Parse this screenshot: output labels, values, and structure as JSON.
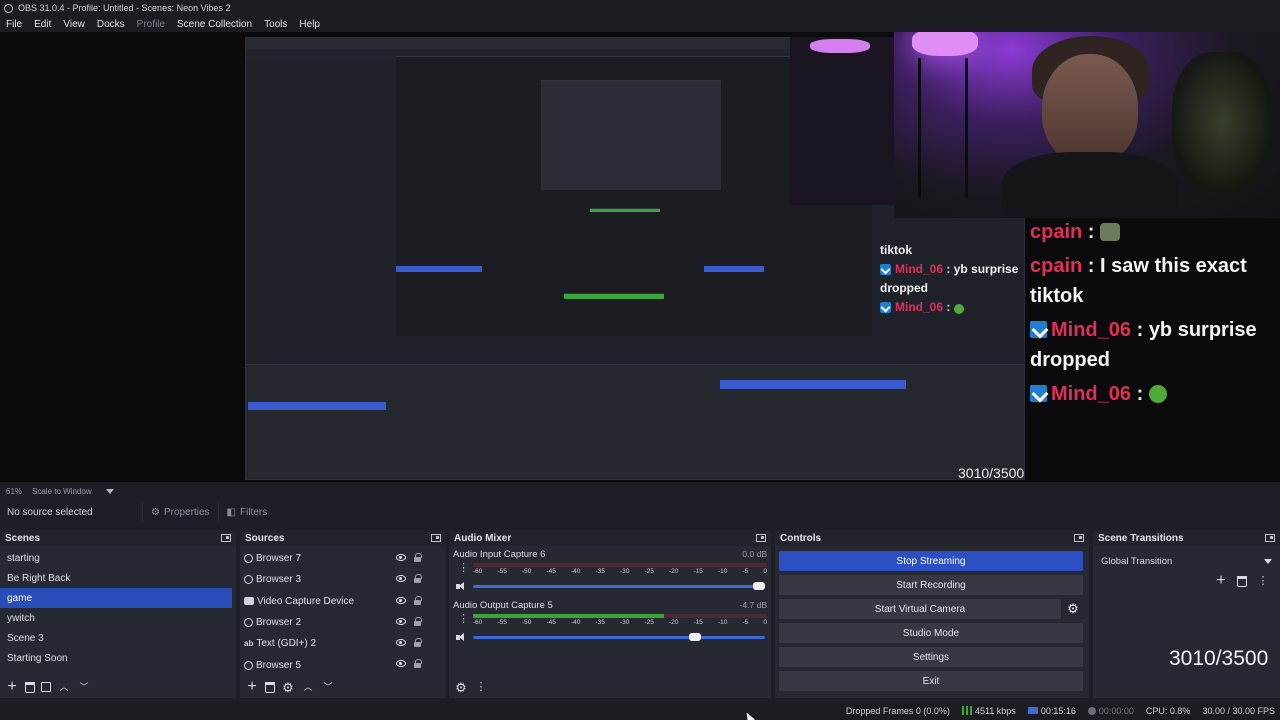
{
  "window": {
    "title": "OBS 31.0.4 - Profile: Untitled - Scenes: Neon Vibes 2"
  },
  "menu": [
    "File",
    "Edit",
    "View",
    "Docks",
    "Profile",
    "Scene Collection",
    "Tools",
    "Help"
  ],
  "preview": {
    "chat_main": [
      {
        "user": "cpain",
        "message": "",
        "emote": true
      },
      {
        "user": "cpain",
        "message": "I saw this exact tiktok"
      },
      {
        "user": "Mind_06",
        "message": "yb surprise dropped",
        "badge": true
      },
      {
        "user": "Mind_06",
        "message": "",
        "badge": true,
        "emote": true
      }
    ],
    "chat_small": [
      {
        "text": "tiktok"
      },
      {
        "user": "Mind_06",
        "message": "yb surprise dropped",
        "badge": true
      },
      {
        "user": "Mind_06",
        "message": "",
        "badge": true,
        "emote": true
      }
    ],
    "counter": "3010/3500"
  },
  "status_strip": {
    "zoom": "61%",
    "scale": "Scale to Window"
  },
  "context_bar": {
    "no_source": "No source selected",
    "properties": "Properties",
    "filters": "Filters"
  },
  "docks": {
    "scenes": {
      "title": "Scenes",
      "items": [
        "starting",
        "Be Right Back",
        "game",
        "ywitch",
        "Scene 3",
        "Starting Soon"
      ],
      "selected_index": 2
    },
    "sources": {
      "title": "Sources",
      "items": [
        {
          "name": "Browser 7",
          "icon": "globe-icon"
        },
        {
          "name": "Browser 3",
          "icon": "globe-icon"
        },
        {
          "name": "Video Capture Device",
          "icon": "camera-icon"
        },
        {
          "name": "Browser 2",
          "icon": "globe-icon"
        },
        {
          "name": "Text (GDI+) 2",
          "icon": "text-icon"
        },
        {
          "name": "Browser 5",
          "icon": "globe-icon"
        }
      ]
    },
    "mixer": {
      "title": "Audio Mixer",
      "ticks": [
        "-60",
        "-55",
        "-50",
        "-45",
        "-40",
        "-35",
        "-30",
        "-25",
        "-20",
        "-15",
        "-10",
        "-5",
        "0"
      ],
      "channels": [
        {
          "name": "Audio Input Capture 6",
          "db": "0.0 dB",
          "level": 0.0,
          "volume": 1.0
        },
        {
          "name": "Audio Output Capture 5",
          "db": "-4.7 dB",
          "level": 0.65,
          "volume": 0.78
        }
      ]
    },
    "controls": {
      "title": "Controls",
      "buttons": [
        "Stop Streaming",
        "Start Recording",
        "Start Virtual Camera",
        "Studio Mode",
        "Settings",
        "Exit"
      ]
    },
    "transitions": {
      "title": "Scene Transitions",
      "selected": "Global Transition"
    }
  },
  "counter": "3010/3500",
  "statusbar": {
    "dropped": "Dropped Frames 0 (0.0%)",
    "kbps": "4511 kbps",
    "stream_time": "00:15:16",
    "rec_time": "00:00:00",
    "cpu": "CPU: 0.8%",
    "fps": "30.00 / 30.00 FPS"
  },
  "colors": {
    "accent": "#2c4fc4",
    "chat_user": "#e0305a",
    "background": "#1d1f26"
  }
}
